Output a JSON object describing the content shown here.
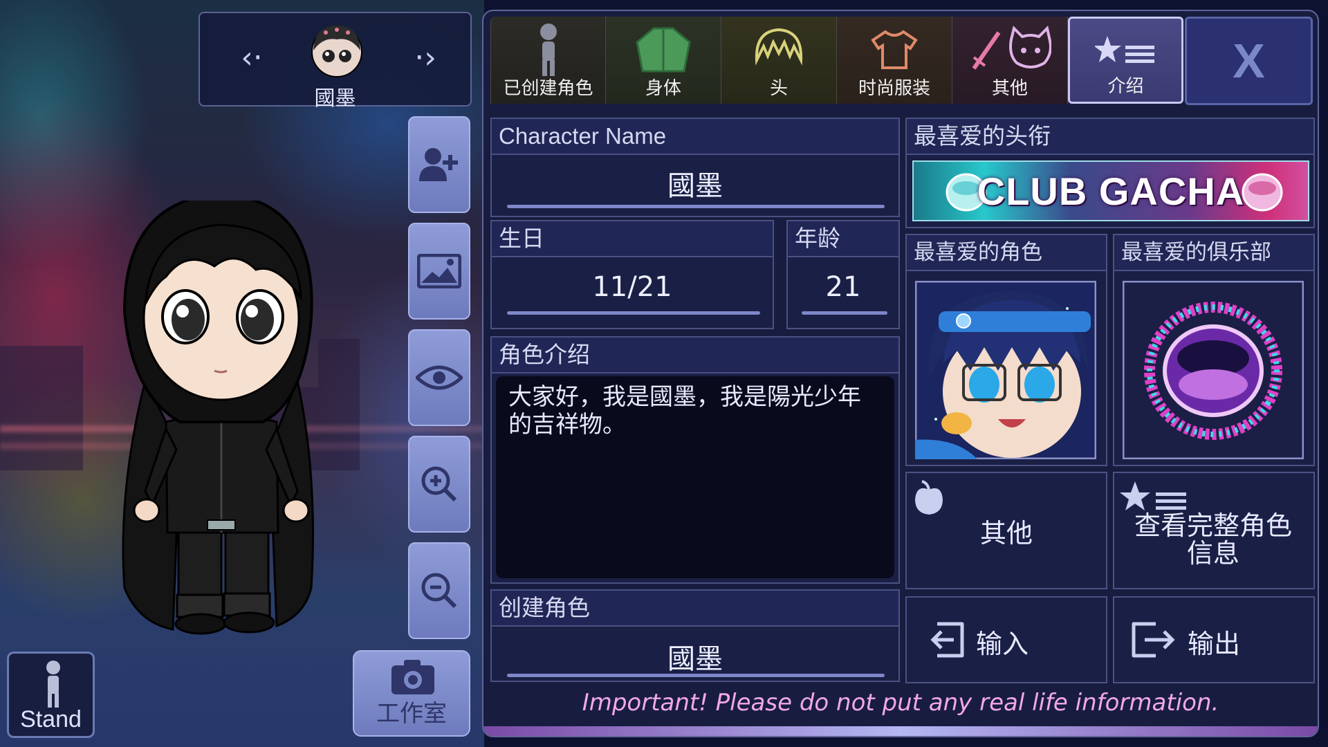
{
  "character_switcher": {
    "name": "國墨",
    "prev_arrow": "‹·",
    "next_arrow": "·›"
  },
  "tabs": [
    {
      "label": "已创建角色",
      "icon": "mannequin-icon"
    },
    {
      "label": "身体",
      "icon": "jacket-icon"
    },
    {
      "label": "头",
      "icon": "hair-icon"
    },
    {
      "label": "时尚服装",
      "icon": "tshirt-icon"
    },
    {
      "label": "其他",
      "icon": "sword-cat-icon"
    },
    {
      "label": "介绍",
      "icon": "star-list-icon"
    }
  ],
  "close_label": "X",
  "side_tools": [
    "add-character-icon",
    "background-image-icon",
    "eye-icon",
    "zoom-in-icon",
    "zoom-out-icon"
  ],
  "stand": {
    "label": "Stand"
  },
  "studio": {
    "label": "工作室"
  },
  "profile": {
    "character_name_label": "Character Name",
    "character_name": "國墨",
    "birthday_label": "生日",
    "birthday": "11/21",
    "age_label": "年龄",
    "age": "21",
    "intro_label": "角色介绍",
    "intro_text": "大家好，我是國墨，我是陽光少年的吉祥物。",
    "creator_label": "创建角色",
    "creator": "國墨",
    "fav_title_label": "最喜爱的头衔",
    "fav_title": "CLUB GACHA",
    "fav_character_label": "最喜爱的角色",
    "fav_club_label": "最喜爱的俱乐部"
  },
  "actions": {
    "other": "其他",
    "view_full_info": "查看完整角色信息",
    "import": "输入",
    "export": "输出"
  },
  "warning": "Important! Please do not put any real life information.",
  "colors": {
    "panel_bg": "#181d40",
    "accent": "#7d87c9",
    "warning_text": "#f2a8e6"
  }
}
